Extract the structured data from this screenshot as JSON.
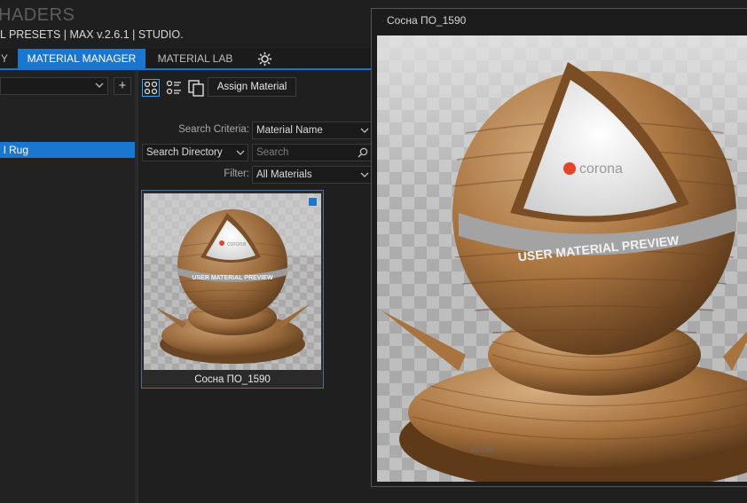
{
  "app": {
    "title": "HADERS",
    "subtitle": "L PRESETS | MAX v.2.6.1 | STUDIO."
  },
  "tabs": [
    {
      "label": "Y",
      "active": false
    },
    {
      "label": "MATERIAL MANAGER",
      "active": true
    },
    {
      "label": "MATERIAL LAB",
      "active": false
    }
  ],
  "left_panel": {
    "library_select_value": "",
    "add_button_label": "+",
    "selected_item": "l Rug"
  },
  "toolbar": {
    "icons": [
      "grid-view-icon",
      "list-view-icon",
      "copy-icon"
    ],
    "assign_label": "Assign Material"
  },
  "search": {
    "criteria_label": "Search Criteria:",
    "criteria_value": "Material Name",
    "directory_value": "Search Directory",
    "search_placeholder": "Search",
    "filter_label": "Filter:",
    "filter_value": "All Materials"
  },
  "thumbnails": [
    {
      "name": "Сосна ПО_1590",
      "checked": true
    }
  ],
  "preview": {
    "title": "Сосна ПО_1590",
    "brand_text": "corona",
    "band_text": "USER MATERIAL PREVIEW",
    "floor_text": "40 CM"
  },
  "colors": {
    "accent": "#1a76cf",
    "background": "#1f1f1f",
    "panel": "#222222"
  }
}
